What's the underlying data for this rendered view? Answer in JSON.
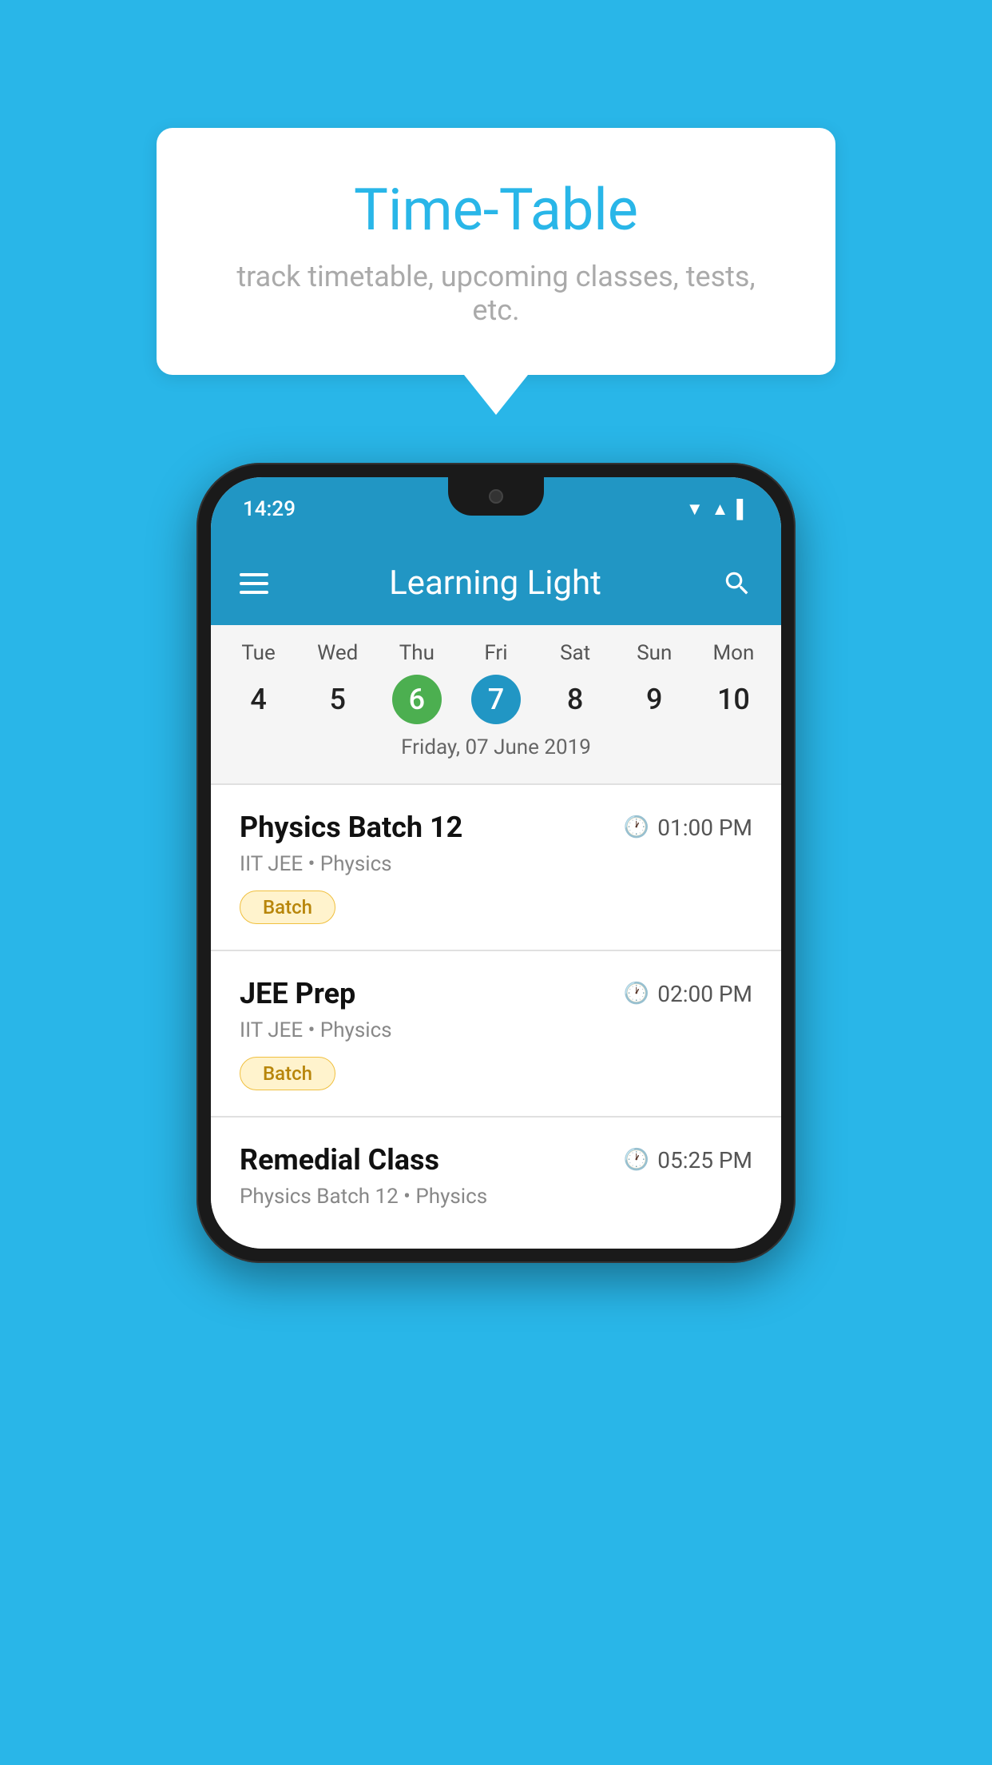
{
  "background_color": "#29B6E8",
  "tooltip": {
    "title": "Time-Table",
    "subtitle": "track timetable, upcoming classes, tests, etc."
  },
  "phone": {
    "status_bar": {
      "time": "14:29"
    },
    "app_bar": {
      "title": "Learning Light",
      "menu_icon": "hamburger-icon",
      "search_icon": "search-icon"
    },
    "calendar": {
      "days": [
        {
          "name": "Tue",
          "num": "4",
          "state": "normal"
        },
        {
          "name": "Wed",
          "num": "5",
          "state": "normal"
        },
        {
          "name": "Thu",
          "num": "6",
          "state": "today"
        },
        {
          "name": "Fri",
          "num": "7",
          "state": "selected"
        },
        {
          "name": "Sat",
          "num": "8",
          "state": "normal"
        },
        {
          "name": "Sun",
          "num": "9",
          "state": "normal"
        },
        {
          "name": "Mon",
          "num": "10",
          "state": "normal"
        }
      ],
      "selected_date_label": "Friday, 07 June 2019"
    },
    "classes": [
      {
        "name": "Physics Batch 12",
        "time": "01:00 PM",
        "meta": "IIT JEE • Physics",
        "tag": "Batch"
      },
      {
        "name": "JEE Prep",
        "time": "02:00 PM",
        "meta": "IIT JEE • Physics",
        "tag": "Batch"
      },
      {
        "name": "Remedial Class",
        "time": "05:25 PM",
        "meta": "Physics Batch 12 • Physics",
        "tag": null
      }
    ]
  }
}
